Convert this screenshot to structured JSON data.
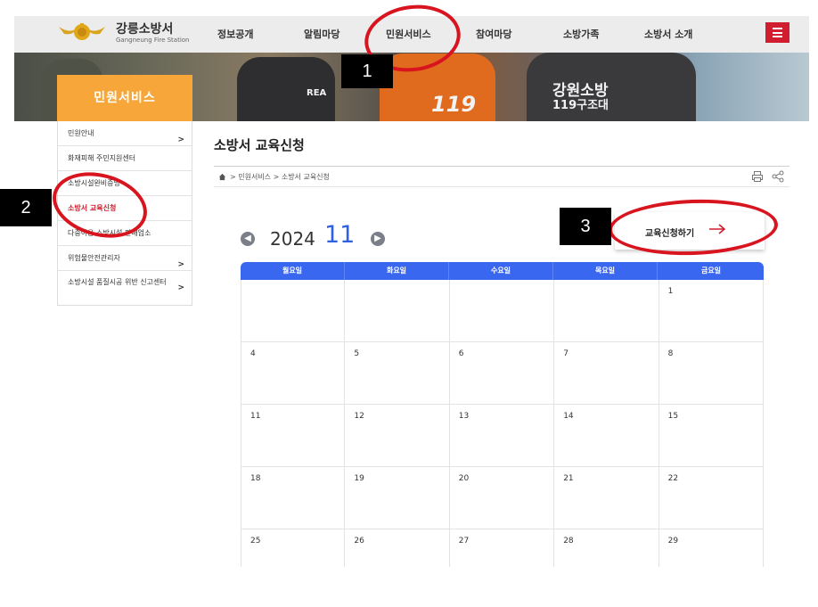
{
  "header": {
    "logo_title": "강릉소방서",
    "logo_subtitle": "Gangneung Fire Station",
    "nav": [
      {
        "label": "정보공개"
      },
      {
        "label": "알림마당"
      },
      {
        "label": "민원서비스"
      },
      {
        "label": "참여마당"
      },
      {
        "label": "소방가족"
      },
      {
        "label": "소방서 소개"
      }
    ],
    "menu_icon": "hamburger-icon",
    "accent_color": "#d01d2f"
  },
  "banner": {
    "vest_text_1": "REA",
    "vest_text_2": "119",
    "vest_text_3": "강원소방",
    "vest_text_4": "119구조대"
  },
  "sidebar": {
    "section_title": "민원서비스",
    "section_color": "#f7a63a",
    "items": [
      {
        "label": "민원안내",
        "has_arrow": true
      },
      {
        "label": "화재피해 주민지원센터",
        "has_arrow": false
      },
      {
        "label": "소방시설완비증명",
        "has_arrow": false
      },
      {
        "label": "소방서 교육신청",
        "has_arrow": false,
        "active": true
      },
      {
        "label": "다중이용 소방시설 판매업소",
        "has_arrow": false
      },
      {
        "label": "위험물안전관리자",
        "has_arrow": true
      },
      {
        "label": "소방시설 품질시공 위반 신고센터",
        "has_arrow": true
      }
    ],
    "arrow_glyph": ">"
  },
  "content": {
    "page_title": "소방서 교육신청",
    "breadcrumb": "> 민원서비스 > 소방서 교육신청",
    "home_icon": "home-icon",
    "print_icon": "print-icon",
    "share_icon": "share-icon"
  },
  "calendar": {
    "year": "2024",
    "month": "11",
    "prev_icon": "arrow-left-circle-icon",
    "next_icon": "arrow-right-circle-icon",
    "apply_label": "교육신청하기",
    "apply_icon": "arrow-right-icon",
    "weekdays": [
      "월요일",
      "화요일",
      "수요일",
      "목요일",
      "금요일"
    ],
    "weeks": [
      [
        "",
        "",
        "",
        "",
        "1"
      ],
      [
        "4",
        "5",
        "6",
        "7",
        "8"
      ],
      [
        "11",
        "12",
        "13",
        "14",
        "15"
      ],
      [
        "18",
        "19",
        "20",
        "21",
        "22"
      ],
      [
        "25",
        "26",
        "27",
        "28",
        "29"
      ]
    ],
    "header_color": "#3a67f0"
  },
  "annotations": [
    {
      "label": "1"
    },
    {
      "label": "2"
    },
    {
      "label": "3"
    }
  ]
}
